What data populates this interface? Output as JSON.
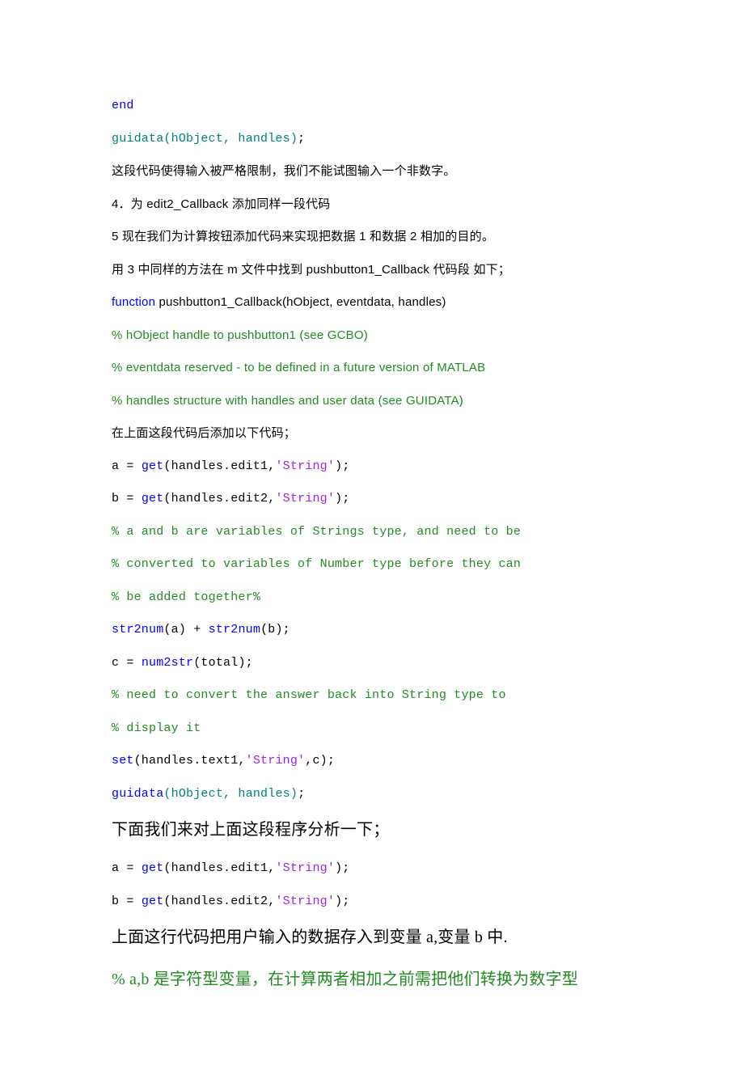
{
  "lines": {
    "l1": "end",
    "l2a": "guidata(hObject, handles)",
    "l2b": ";",
    "l3": "这段代码使得输入被严格限制，我们不能试图输入一个非数字。",
    "l4": "4．为 edit2_Callback 添加同样一段代码",
    "l5": "5  现在我们为计算按钮添加代码来实现把数据 1 和数据 2 相加的目的。",
    "l6": "用 3 中同样的方法在 m 文件中找到 pushbutton1_Callback 代码段  如下；",
    "l7a": "function",
    "l7b": " pushbutton1_Callback(hObject, eventdata, handles)",
    "l8": "% hObject handle to pushbutton1 (see GCBO)",
    "l9": "% eventdata reserved - to be defined in a future version of MATLAB",
    "l10": "% handles structure with handles and user data (see GUIDATA)",
    "l11": "在上面这段代码后添加以下代码；",
    "l12a": "a = ",
    "l12b": "get",
    "l12c": "(handles.edit1,",
    "l12d": "'String'",
    "l12e": ");",
    "l13a": "b = ",
    "l13b": "get",
    "l13c": "(handles.edit2,",
    "l13d": "'String'",
    "l13e": ");",
    "l14": "% a and b are variables of Strings type, and need to be",
    "l15": "% converted to variables of Number type before they can",
    "l16": "% be added together%",
    "l17a": "str2num",
    "l17b": "(a) + ",
    "l17c": "str2num",
    "l17d": "(b);",
    "l18a": "c = ",
    "l18b": "num2str",
    "l18c": "(total);",
    "l19": "% need to convert the answer back into String type to",
    "l20": "% display it",
    "l21a": "set",
    "l21b": "(handles.text1,",
    "l21c": "'String'",
    "l21d": ",c);",
    "l22a": "guidata",
    "l22b": "(hObject, handles)",
    "l22c": ";",
    "l23": "下面我们来对上面这段程序分析一下；",
    "l24a": "a = ",
    "l24b": "get",
    "l24c": "(handles.edit1,",
    "l24d": "'String'",
    "l24e": ");",
    "l25a": "b = ",
    "l25b": "get",
    "l25c": "(handles.edit2,",
    "l25d": "'String'",
    "l25e": ");",
    "l26": "上面这行代码把用户输入的数据存入到变量 a,变量 b 中.",
    "l27": "% a,b 是字符型变量，在计算两者相加之前需把他们转换为数字型"
  }
}
